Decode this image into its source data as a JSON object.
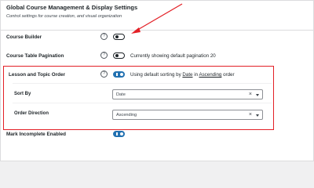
{
  "panel": {
    "title": "Global Course Management & Display Settings",
    "description": "Control settings for course creation, and visual organization"
  },
  "rows": {
    "course_builder": {
      "label": "Course Builder",
      "enabled": false
    },
    "pagination": {
      "label": "Course Table Pagination",
      "enabled": false,
      "status": "Currently showing default pagination 20"
    },
    "lesson_order": {
      "label": "Lesson and Topic Order",
      "enabled": true,
      "status_prefix": "Using default sorting by",
      "status_field": "Date",
      "status_mid": "in",
      "status_direction": "Ascending",
      "status_suffix": "order",
      "sort_by_label": "Sort By",
      "sort_by_value": "Date",
      "order_direction_label": "Order Direction",
      "order_direction_value": "Ascending"
    },
    "mark_incomplete": {
      "label": "Mark Incomplete Enabled",
      "enabled": true
    }
  },
  "glyphs": {
    "help": "?",
    "clear": "×"
  },
  "colors": {
    "annotation_red": "#e32026",
    "toggle_on": "#2271b1"
  }
}
